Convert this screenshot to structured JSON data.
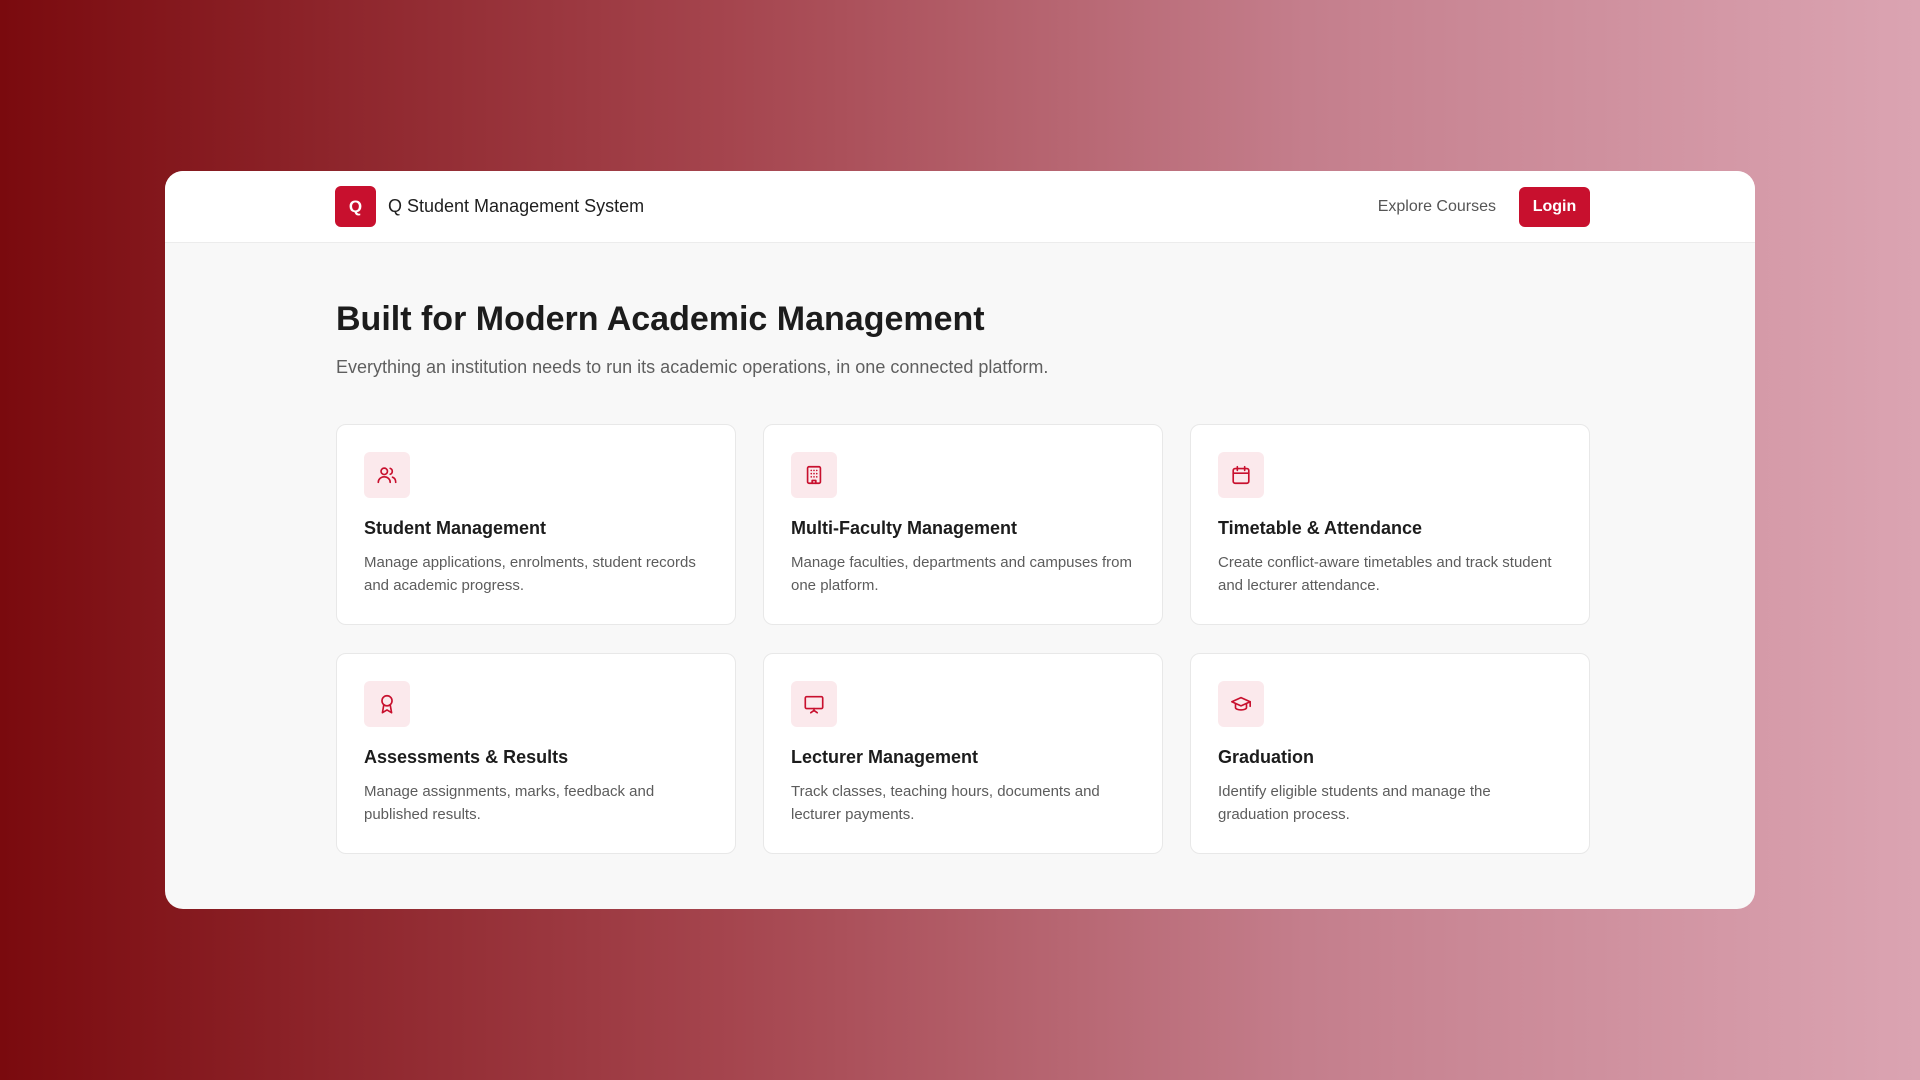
{
  "header": {
    "logo_letter": "Q",
    "app_name": "Q Student Management System",
    "nav_link": "Explore Courses",
    "login_label": "Login"
  },
  "hero": {
    "title": "Built for Modern Academic Management",
    "subtitle": "Everything an institution needs to run its academic operations, in one connected platform."
  },
  "features": [
    {
      "icon": "users-icon",
      "title": "Student Management",
      "description": "Manage applications, enrolments, student records and academic progress."
    },
    {
      "icon": "building-icon",
      "title": "Multi-Faculty Management",
      "description": "Manage faculties, departments and campuses from one platform."
    },
    {
      "icon": "calendar-icon",
      "title": "Timetable & Attendance",
      "description": "Create conflict-aware timetables and track student and lecturer attendance."
    },
    {
      "icon": "award-icon",
      "title": "Assessments & Results",
      "description": "Manage assignments, marks, feedback and published results."
    },
    {
      "icon": "presentation-icon",
      "title": "Lecturer Management",
      "description": "Track classes, teaching hours, documents and lecturer payments."
    },
    {
      "icon": "graduation-cap-icon",
      "title": "Graduation",
      "description": "Identify eligible students and manage the graduation process."
    }
  ],
  "colors": {
    "accent": "#c8102e",
    "icon_bg": "#fbe9ec",
    "page_bg": "#f8f8f8"
  }
}
